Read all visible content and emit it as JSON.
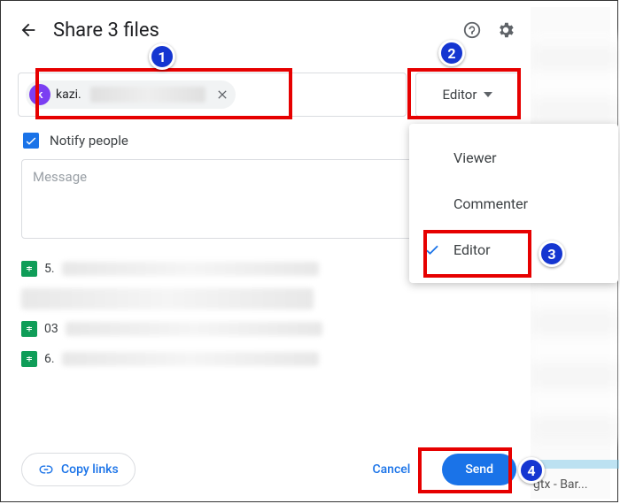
{
  "header": {
    "title": "Share 3 files"
  },
  "people": {
    "chip_avatar_letter": "k",
    "chip_label": "kazi."
  },
  "role_select": {
    "selected": "Editor"
  },
  "notify": {
    "label": "Notify people",
    "checked": true
  },
  "message": {
    "placeholder": "Message"
  },
  "files": [
    {
      "prefix": "5."
    },
    {
      "prefix": "03"
    },
    {
      "prefix": "6."
    }
  ],
  "footer": {
    "copy_links": "Copy links",
    "cancel": "Cancel",
    "send": "Send"
  },
  "dropdown": {
    "items": [
      {
        "label": "Viewer",
        "selected": false
      },
      {
        "label": "Commenter",
        "selected": false
      },
      {
        "label": "Editor",
        "selected": true
      }
    ]
  },
  "background": {
    "partial_text": "gtx - Bar..."
  },
  "annotations": {
    "m1": "1",
    "m2": "2",
    "m3": "3",
    "m4": "4"
  }
}
